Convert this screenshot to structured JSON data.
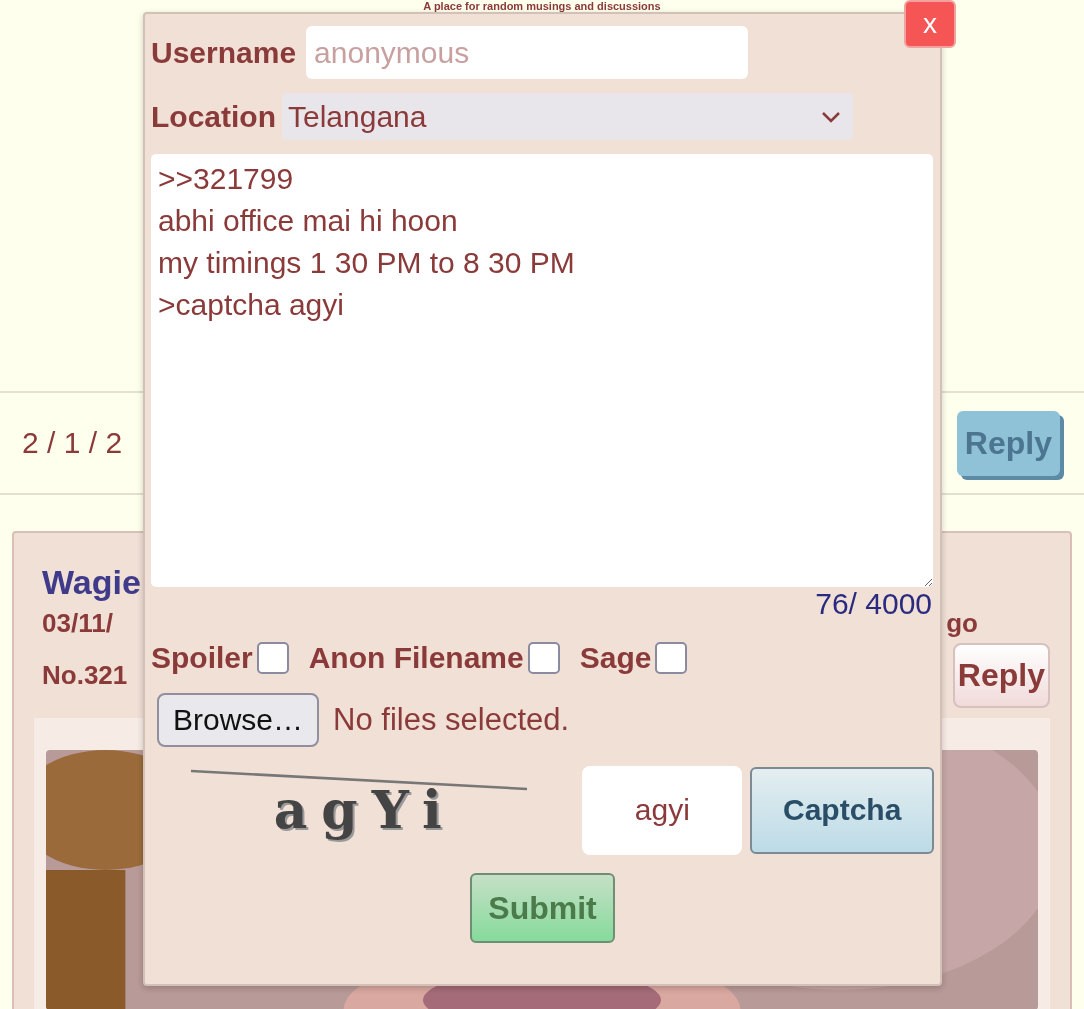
{
  "header": {
    "tagline": "A place for random musings and discussions"
  },
  "thread_bar": {
    "pages": "2 / 1 / 2",
    "reply_button": "Reply"
  },
  "post": {
    "title": "Wagie",
    "date": "03/11/",
    "age": "go",
    "number": "No.321",
    "reply_button": "Reply"
  },
  "reply_form": {
    "close_button": "x",
    "username": {
      "label": "Username",
      "placeholder": "anonymous"
    },
    "location": {
      "label": "Location",
      "value": "Telangana"
    },
    "message": {
      "value": ">>321799\nabhi office mai hi hoon\nmy timings 1 30 PM to 8 30 PM\n>captcha agyi",
      "counter": "76/ 4000"
    },
    "options": [
      {
        "label": "Spoiler",
        "checked": false
      },
      {
        "label": "Anon Filename",
        "checked": false
      },
      {
        "label": "Sage",
        "checked": false
      }
    ],
    "file": {
      "button": "Browse…",
      "status": "No files selected."
    },
    "captcha": {
      "image_text": "agYi",
      "answer": "agyi",
      "button": "Captcha"
    },
    "submit_button": "Submit"
  }
}
